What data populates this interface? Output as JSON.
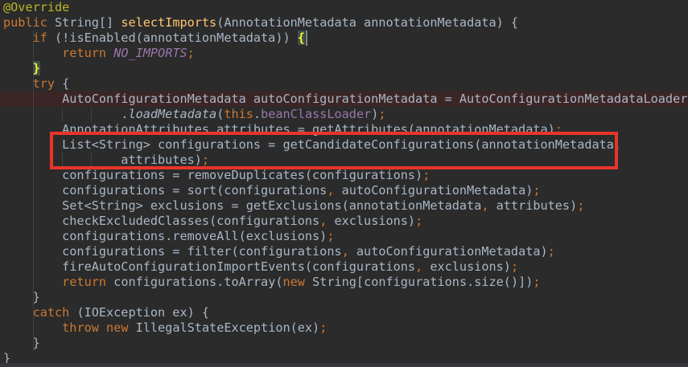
{
  "editor": {
    "language": "java",
    "description": "Java source of selectImports method in an IDE editor, dark theme"
  },
  "syntax_colors": {
    "background": "#2B2B2B",
    "default": "#A9B7C6",
    "keyword": "#CC7832",
    "annotation": "#BBB529",
    "method_declaration": "#FFC66D",
    "field": "#9876AA",
    "constant": "#9876AA",
    "static_method": "#A9B7C6",
    "punctuation": "#CC7832",
    "matched_brace_fg": "#FFEF28",
    "matched_brace_bg": "#3B514D",
    "execution_line_bg": "#3C2526",
    "annotation_box_border": "#E8352C",
    "indent_guide": "#3E4244",
    "caret": "#808890"
  },
  "code": {
    "lines": [
      {
        "tokens": [
          [
            "a",
            "@Override"
          ]
        ]
      },
      {
        "tokens": [
          [
            "k",
            "public"
          ],
          [
            "t",
            " String[] "
          ],
          [
            "m",
            "selectImports"
          ],
          [
            "t",
            "(AnnotationMetadata annotationMetadata) {"
          ]
        ]
      },
      {
        "tokens": [
          [
            "t",
            "    "
          ],
          [
            "k",
            "if"
          ],
          [
            "t",
            " (!isEnabled(annotationMetadata)) "
          ],
          [
            "b",
            "{"
          ],
          [
            "caret",
            ""
          ]
        ]
      },
      {
        "tokens": [
          [
            "t",
            "        "
          ],
          [
            "k",
            "return"
          ],
          [
            "t",
            " "
          ],
          [
            "c",
            "NO_IMPORTS"
          ],
          [
            "p",
            ";"
          ]
        ]
      },
      {
        "tokens": [
          [
            "t",
            "    "
          ],
          [
            "b",
            "}"
          ]
        ]
      },
      {
        "tokens": [
          [
            "t",
            "    "
          ],
          [
            "k",
            "try"
          ],
          [
            "t",
            " {"
          ]
        ]
      },
      {
        "tokens": [
          [
            "t",
            "        AutoConfigurationMetadata autoConfigurationMetadata = AutoConfigurationMetadataLoader"
          ]
        ]
      },
      {
        "tokens": [
          [
            "t",
            "                ."
          ],
          [
            "s",
            "loadMetadata"
          ],
          [
            "t",
            "("
          ],
          [
            "k",
            "this"
          ],
          [
            "t",
            "."
          ],
          [
            "f",
            "beanClassLoader"
          ],
          [
            "t",
            ")"
          ],
          [
            "p",
            ";"
          ]
        ]
      },
      {
        "tokens": [
          [
            "t",
            "        AnnotationAttributes attributes = getAttributes(annotationMetadata)"
          ],
          [
            "p",
            ";"
          ]
        ]
      },
      {
        "tokens": [
          [
            "t",
            "        List<String> configurations = getCandidateConfigurations(annotationMetadata"
          ],
          [
            "p",
            ","
          ]
        ]
      },
      {
        "tokens": [
          [
            "t",
            "                attributes)"
          ],
          [
            "p",
            ";"
          ]
        ]
      },
      {
        "tokens": [
          [
            "t",
            "        configurations = removeDuplicates(configurations)"
          ],
          [
            "p",
            ";"
          ]
        ]
      },
      {
        "tokens": [
          [
            "t",
            "        configurations = sort(configurations"
          ],
          [
            "p",
            ","
          ],
          [
            "t",
            " autoConfigurationMetadata)"
          ],
          [
            "p",
            ";"
          ]
        ]
      },
      {
        "tokens": [
          [
            "t",
            "        Set<String> exclusions = getExclusions(annotationMetadata"
          ],
          [
            "p",
            ","
          ],
          [
            "t",
            " attributes)"
          ],
          [
            "p",
            ";"
          ]
        ]
      },
      {
        "tokens": [
          [
            "t",
            "        checkExcludedClasses(configurations"
          ],
          [
            "p",
            ","
          ],
          [
            "t",
            " exclusions)"
          ],
          [
            "p",
            ";"
          ]
        ]
      },
      {
        "tokens": [
          [
            "t",
            "        configurations.removeAll(exclusions)"
          ],
          [
            "p",
            ";"
          ]
        ]
      },
      {
        "tokens": [
          [
            "t",
            "        configurations = filter(configurations"
          ],
          [
            "p",
            ","
          ],
          [
            "t",
            " autoConfigurationMetadata)"
          ],
          [
            "p",
            ";"
          ]
        ]
      },
      {
        "tokens": [
          [
            "t",
            "        fireAutoConfigurationImportEvents(configurations"
          ],
          [
            "p",
            ","
          ],
          [
            "t",
            " exclusions)"
          ],
          [
            "p",
            ";"
          ]
        ]
      },
      {
        "tokens": [
          [
            "t",
            "        "
          ],
          [
            "k",
            "return"
          ],
          [
            "t",
            " configurations.toArray("
          ],
          [
            "k",
            "new"
          ],
          [
            "t",
            " String[configurations.size()])"
          ],
          [
            "p",
            ";"
          ]
        ]
      },
      {
        "tokens": [
          [
            "t",
            "    }"
          ]
        ]
      },
      {
        "tokens": [
          [
            "t",
            "    "
          ],
          [
            "k",
            "catch"
          ],
          [
            "t",
            " (IOException ex) {"
          ]
        ]
      },
      {
        "tokens": [
          [
            "t",
            "        "
          ],
          [
            "k",
            "throw"
          ],
          [
            "t",
            " "
          ],
          [
            "k",
            "new"
          ],
          [
            "t",
            " IllegalStateException(ex)"
          ],
          [
            "p",
            ";"
          ]
        ]
      },
      {
        "tokens": [
          [
            "t",
            "    }"
          ]
        ]
      },
      {
        "tokens": [
          [
            "t",
            "}"
          ]
        ]
      }
    ]
  },
  "overlays": {
    "execution_line_number": 7,
    "caret_line_number": 3,
    "highlight_box": {
      "from_line": 10,
      "to_line": 11
    }
  }
}
